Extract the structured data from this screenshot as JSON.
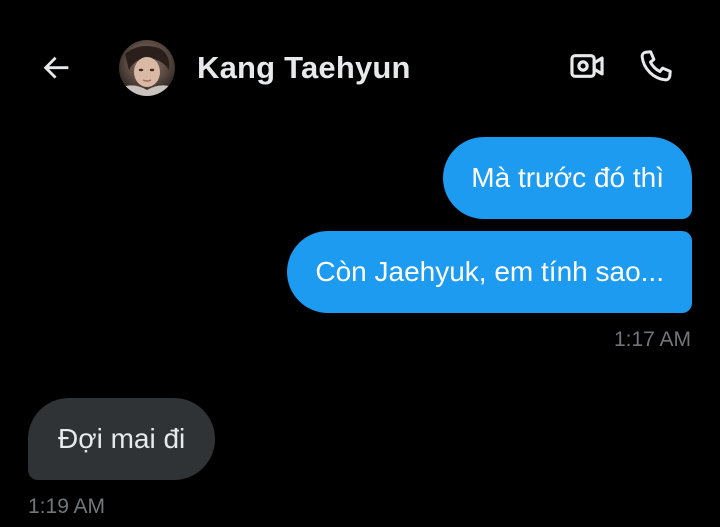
{
  "header": {
    "contact_name": "Kang Taehyun",
    "back_icon": "arrow-left-icon",
    "video_icon": "video-camera-icon",
    "phone_icon": "phone-icon"
  },
  "messages": [
    {
      "direction": "sent",
      "text": "Mà trước đó thì"
    },
    {
      "direction": "sent",
      "text": "Còn Jaehyuk, em tính sao...",
      "timestamp": "1:17 AM"
    },
    {
      "direction": "received",
      "text": "Đợi mai đi",
      "timestamp": "1:19 AM"
    }
  ],
  "colors": {
    "background": "#000000",
    "sent_bubble": "#1d9bf0",
    "received_bubble": "#2f3336",
    "text_primary": "#e7e9ea",
    "text_secondary": "#71767b"
  }
}
